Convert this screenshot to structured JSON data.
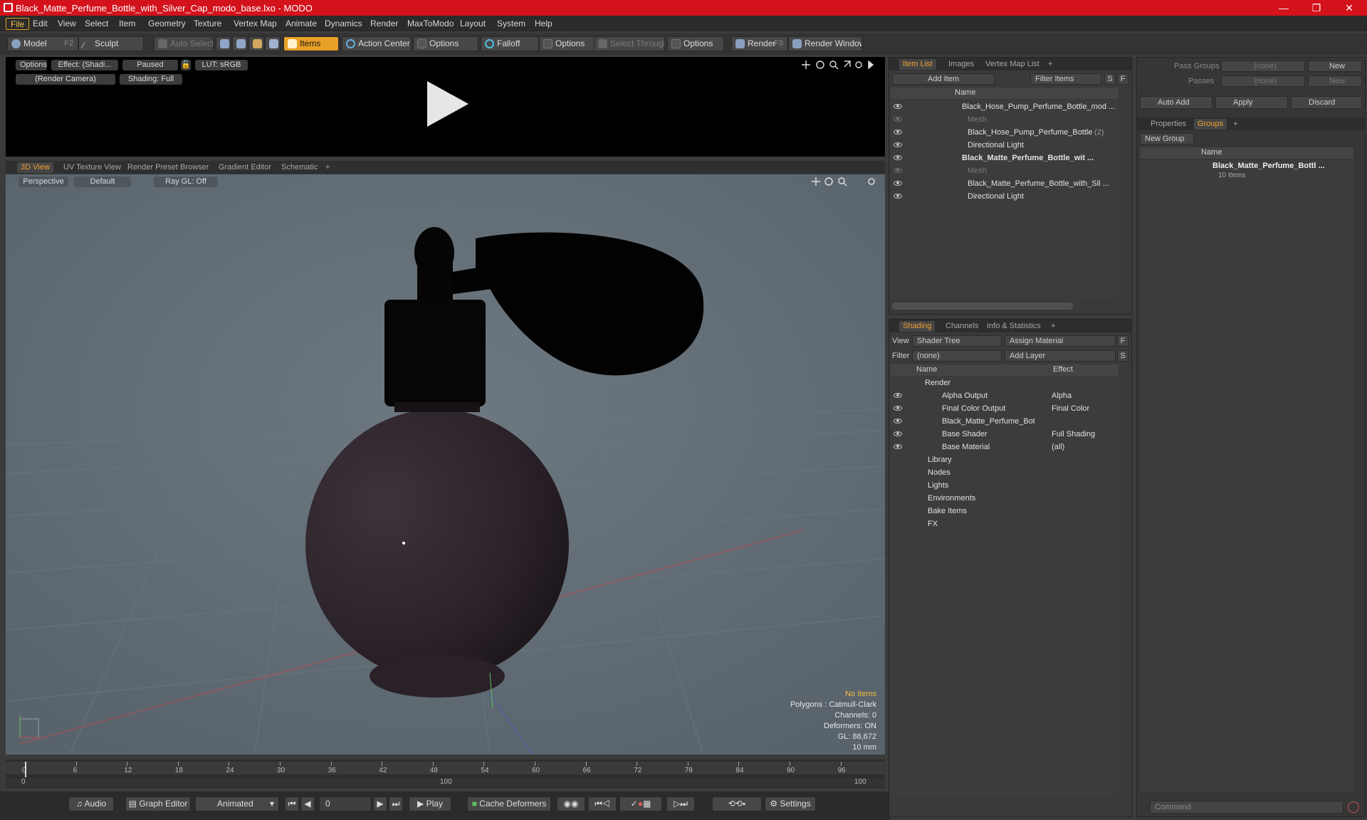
{
  "window": {
    "title": "Black_Matte_Perfume_Bottle_with_Silver_Cap_modo_base.lxo - MODO",
    "minimize_glyph": "—",
    "maximize_glyph": "❐",
    "close_glyph": "✕"
  },
  "menu": [
    "File",
    "Edit",
    "View",
    "Select",
    "Item",
    "Geometry",
    "Texture",
    "Vertex Map",
    "Animate",
    "Dynamics",
    "Render",
    "MaxToModo",
    "Layout",
    "System",
    "Help"
  ],
  "toolbar": {
    "model": "Model",
    "model_key": "F2",
    "sculpt": "Sculpt",
    "auto_select": "Auto Select",
    "items": "Items",
    "action_center": "Action Center",
    "options1": "Options",
    "falloff": "Falloff",
    "options2": "Options",
    "select_through": "Select Through",
    "options3": "Options",
    "render": "Render",
    "render_key": "F9",
    "render_window": "Render Window"
  },
  "preview": {
    "options": "Options",
    "effect": "Effect: (Shadi...",
    "paused": "Paused",
    "lut": "LUT: sRGB",
    "camera": "(Render Camera)",
    "shading": "Shading: Full"
  },
  "viewport_tabs": [
    "3D View",
    "UV Texture View",
    "Render Preset Browser",
    "Gradient Editor",
    "Schematic",
    "+"
  ],
  "viewport": {
    "perspective": "Perspective",
    "default": "Default",
    "raygl": "Ray GL: Off",
    "hud": {
      "no_items": "No Items",
      "polygons": "Polygons : Catmull-Clark",
      "channels": "Channels: 0",
      "deformers": "Deformers: ON",
      "gl": "GL: 88,672",
      "scale": "10 mm"
    }
  },
  "timeline": {
    "ticks": [
      "0",
      "6",
      "12",
      "18",
      "24",
      "30",
      "36",
      "42",
      "48",
      "54",
      "60",
      "66",
      "72",
      "78",
      "84",
      "90",
      "96"
    ],
    "lower_ticks": [
      "0",
      "100",
      "100"
    ]
  },
  "bottombar": {
    "audio": "Audio",
    "graph_editor": "Graph Editor",
    "animated": "Animated",
    "frame": "0",
    "play": "Play",
    "cache_deformers": "Cache Deformers",
    "settings": "Settings"
  },
  "item_list": {
    "tabs": [
      "Item List",
      "Images",
      "Vertex Map List",
      "+"
    ],
    "add_item": "Add Item",
    "filter_items": "Filter Items",
    "s": "S",
    "f": "F",
    "name_header": "Name",
    "rows": [
      {
        "label": "Black_Hose_Pump_Perfume_Bottle_mod ...",
        "indent": 0,
        "bold": false,
        "dim": false
      },
      {
        "label": "Mesh",
        "indent": 1,
        "bold": false,
        "dim": true
      },
      {
        "label": "Black_Hose_Pump_Perfume_Bottle",
        "suffix": "(2)",
        "indent": 1,
        "bold": false,
        "dim": false
      },
      {
        "label": "Directional Light",
        "indent": 1,
        "bold": false,
        "dim": false
      },
      {
        "label": "Black_Matte_Perfume_Bottle_wit ...",
        "indent": 0,
        "bold": true,
        "dim": false
      },
      {
        "label": "Mesh",
        "indent": 1,
        "bold": false,
        "dim": true
      },
      {
        "label": "Black_Matte_Perfume_Bottle_with_Sil ...",
        "indent": 1,
        "bold": false,
        "dim": false
      },
      {
        "label": "Directional Light",
        "indent": 1,
        "bold": false,
        "dim": false
      }
    ]
  },
  "shading": {
    "tabs": [
      "Shading",
      "Channels",
      "Info & Statistics",
      "+"
    ],
    "view_label": "View",
    "view_value": "Shader Tree",
    "assign_material": "Assign Material",
    "filter_label": "Filter",
    "filter_value": "(none)",
    "add_layer": "Add Layer",
    "f": "F",
    "s": "S",
    "name_header": "Name",
    "effect_header": "Effect",
    "rows": [
      {
        "label": "Render",
        "effect": ""
      },
      {
        "label": "Alpha Output",
        "effect": "Alpha"
      },
      {
        "label": "Final Color Output",
        "effect": "Final Color"
      },
      {
        "label": "Black_Matte_Perfume_Bot ...",
        "effect": ""
      },
      {
        "label": "Base Shader",
        "effect": "Full Shading"
      },
      {
        "label": "Base Material",
        "effect": "(all)"
      },
      {
        "label": "Library",
        "effect": ""
      },
      {
        "label": "Nodes",
        "effect": ""
      },
      {
        "label": "Lights",
        "effect": ""
      },
      {
        "label": "Environments",
        "effect": ""
      },
      {
        "label": "Bake Items",
        "effect": ""
      },
      {
        "label": "FX",
        "effect": ""
      }
    ]
  },
  "groups": {
    "pass_groups_label": "Pass Groups",
    "pass_groups_value": "(none)",
    "new": "New",
    "passes_label": "Passes",
    "passes_value": "(none)",
    "new2": "New",
    "auto_add": "Auto Add",
    "apply": "Apply",
    "discard": "Discard",
    "tabs": [
      "Properties",
      "Groups",
      "+"
    ],
    "new_group": "New Group",
    "name_header": "Name",
    "group_name": "Black_Matte_Perfume_Bottl ...",
    "group_count": "10 Items",
    "command_placeholder": "Command"
  }
}
